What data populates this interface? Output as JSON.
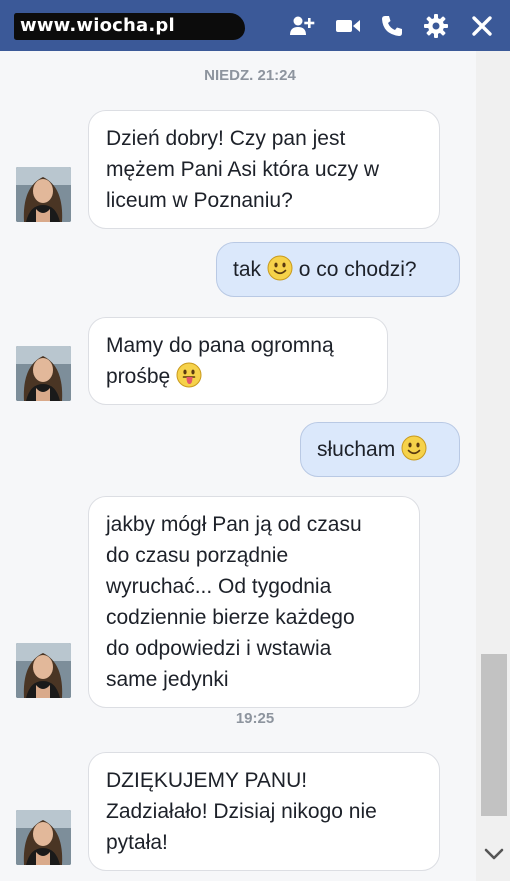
{
  "header": {
    "watermark": "www.wiocha.pl",
    "icons": [
      "add-person-icon",
      "video-call-icon",
      "phone-icon",
      "gear-icon",
      "close-icon"
    ],
    "color": "#3b5998"
  },
  "conversation": {
    "timestamp_1": "NIEDZ. 21:24",
    "timestamp_2": "19:25",
    "msg1_lines": [
      "Dzień dobry! Czy pan jest",
      "mężem Pani Asi która uczy w",
      "liceum w Poznaniu?"
    ],
    "msg2_before": "tak",
    "msg2_after": "o co chodzi?",
    "msg3_lines": [
      "Mamy do pana ogromną",
      "prośbę"
    ],
    "msg4": "słucham",
    "msg5_lines": [
      "jakby mógł Pan ją od czasu",
      "do czasu porządnie",
      "wyruchać... Od tygodnia",
      "codziennie bierze każdego",
      "do odpowiedzi i wstawia",
      "same jedynki"
    ],
    "msg6_lines": [
      "DZIĘKUJEMY PANU!",
      "Zadziałało! Dzisiaj nikogo nie",
      "pytała!"
    ]
  },
  "colors": {
    "incoming_bubble": "#ffffff",
    "outgoing_bubble": "#dbe8fb",
    "timestamp": "#8d949e"
  }
}
